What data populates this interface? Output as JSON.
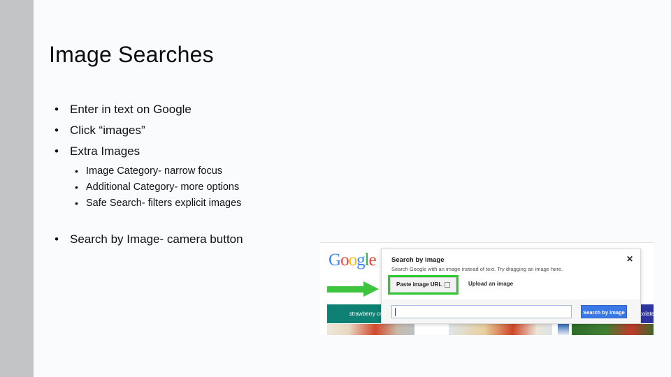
{
  "slide": {
    "title": "Image Searches",
    "bullets": [
      {
        "text": "Enter in text on Google",
        "sub": []
      },
      {
        "text": "Click “images”",
        "sub": []
      },
      {
        "text": "Extra Images",
        "sub": [
          "Image Category- narrow focus",
          "Additional Category- more options",
          "Safe Search- filters explicit images"
        ]
      }
    ],
    "final_bullet": "Search by Image- camera button",
    "bullet_glyph": "•",
    "sub_bullet_glyph": "•"
  },
  "screenshot": {
    "logo": {
      "letters": [
        "G",
        "o",
        "o",
        "g",
        "l",
        "e"
      ]
    },
    "chips": [
      {
        "label": "strawberry cream",
        "color": "#0e8074"
      },
      {
        "label": "chocolate",
        "color": "#2f35a0"
      }
    ],
    "dialog": {
      "title": "Search by image",
      "subtitle": "Search Google with an image instead of text. Try dragging an image here.",
      "close_label": "✕",
      "tab_paste": "Paste image URL",
      "tab_upload": "Upload an image",
      "input_value": "",
      "input_placeholder": "",
      "search_button": "Search by image",
      "highlight_color": "#2ecc2e",
      "button_color": "#3b78e7"
    },
    "arrow_color": "#3ec53e"
  },
  "theme": {
    "background": "#fafbfd",
    "sidebar": "#c2c3c5",
    "text": "#111111"
  }
}
